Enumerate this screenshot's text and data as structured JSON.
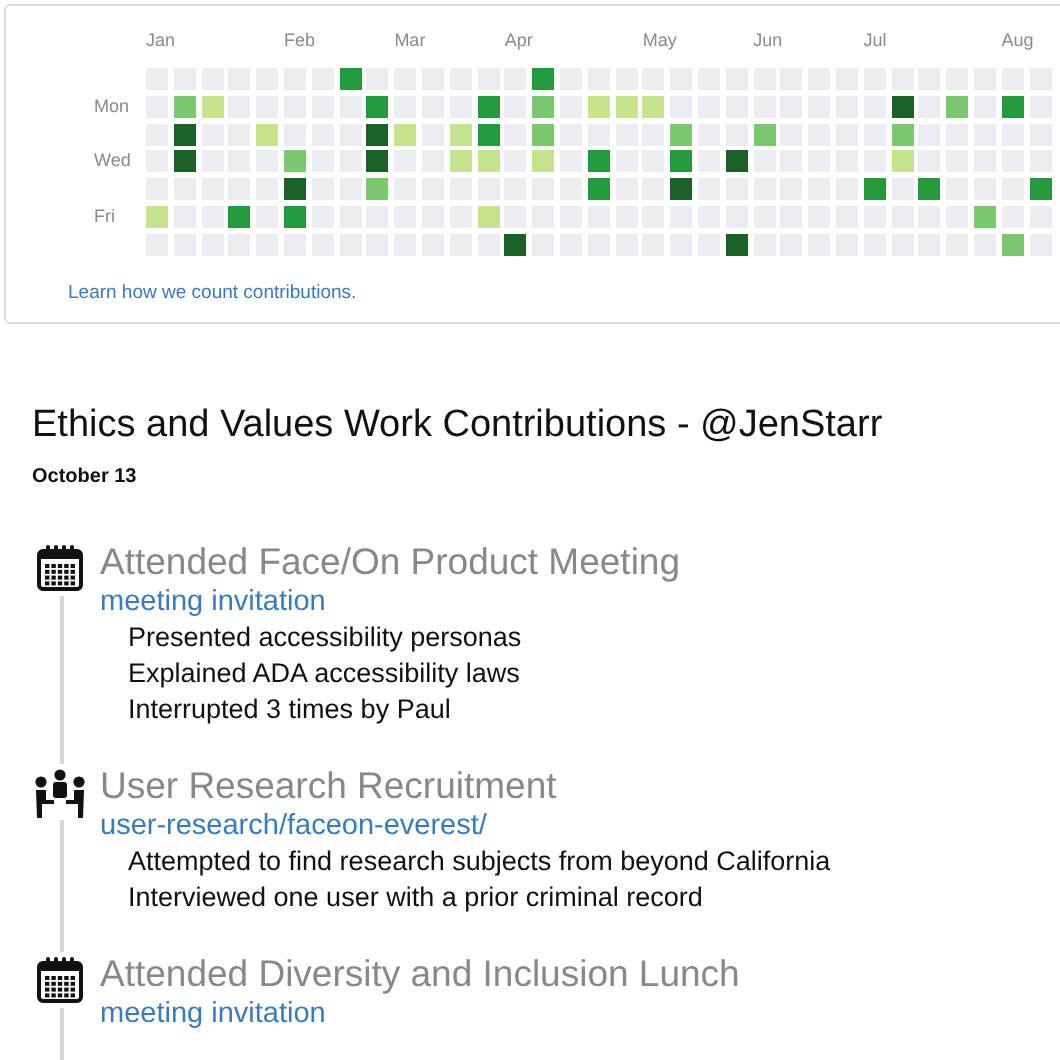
{
  "graph": {
    "months": [
      "Jan",
      "Feb",
      "Mar",
      "Apr",
      "May",
      "Jun",
      "Jul",
      "Aug"
    ],
    "day_labels": [
      "Mon",
      "Wed",
      "Fri"
    ],
    "weeks": [
      [
        {
          "color": "#ebedf0"
        },
        {
          "color": "#ebedf0"
        },
        {
          "color": "#ebedf0"
        },
        {
          "color": "#ebedf0"
        },
        {
          "color": "#ebedf0"
        },
        {
          "color": "#c6e48b"
        },
        {
          "color": "#ebedf0"
        }
      ],
      [
        {
          "color": "#ebedf0"
        },
        {
          "color": "#7bc96f"
        },
        {
          "color": "#196127"
        },
        {
          "color": "#196127"
        },
        {
          "color": "#ebedf0"
        },
        {
          "color": "#ebedf0"
        },
        {
          "color": "#ebedf0"
        }
      ],
      [
        {
          "color": "#ebedf0"
        },
        {
          "color": "#c6e48b"
        },
        {
          "color": "#ebedf0"
        },
        {
          "color": "#ebedf0"
        },
        {
          "color": "#ebedf0"
        },
        {
          "color": "#ebedf0"
        },
        {
          "color": "#ebedf0"
        }
      ],
      [
        {
          "color": "#ebedf0"
        },
        {
          "color": "#ebedf0"
        },
        {
          "color": "#ebedf0"
        },
        {
          "color": "#ebedf0"
        },
        {
          "color": "#ebedf0"
        },
        {
          "color": "#239a3b"
        },
        {
          "color": "#ebedf0"
        }
      ],
      [
        {
          "color": "#ebedf0"
        },
        {
          "color": "#ebedf0"
        },
        {
          "color": "#c6e48b"
        },
        {
          "color": "#ebedf0"
        },
        {
          "color": "#ebedf0"
        },
        {
          "color": "#ebedf0"
        },
        {
          "color": "#ebedf0"
        }
      ],
      [
        {
          "color": "#ebedf0"
        },
        {
          "color": "#ebedf0"
        },
        {
          "color": "#ebedf0"
        },
        {
          "color": "#7bc96f"
        },
        {
          "color": "#196127"
        },
        {
          "color": "#239a3b"
        },
        {
          "color": "#ebedf0"
        }
      ],
      [
        {
          "color": "#ebedf0"
        },
        {
          "color": "#ebedf0"
        },
        {
          "color": "#ebedf0"
        },
        {
          "color": "#ebedf0"
        },
        {
          "color": "#ebedf0"
        },
        {
          "color": "#ebedf0"
        },
        {
          "color": "#ebedf0"
        }
      ],
      [
        {
          "color": "#239a3b"
        },
        {
          "color": "#ebedf0"
        },
        {
          "color": "#ebedf0"
        },
        {
          "color": "#ebedf0"
        },
        {
          "color": "#ebedf0"
        },
        {
          "color": "#ebedf0"
        },
        {
          "color": "#ebedf0"
        }
      ],
      [
        {
          "color": "#ebedf0"
        },
        {
          "color": "#239a3b"
        },
        {
          "color": "#196127"
        },
        {
          "color": "#196127"
        },
        {
          "color": "#7bc96f"
        },
        {
          "color": "#ebedf0"
        },
        {
          "color": "#ebedf0"
        }
      ],
      [
        {
          "color": "#ebedf0"
        },
        {
          "color": "#ebedf0"
        },
        {
          "color": "#c6e48b"
        },
        {
          "color": "#ebedf0"
        },
        {
          "color": "#ebedf0"
        },
        {
          "color": "#ebedf0"
        },
        {
          "color": "#ebedf0"
        }
      ],
      [
        {
          "color": "#ebedf0"
        },
        {
          "color": "#ebedf0"
        },
        {
          "color": "#ebedf0"
        },
        {
          "color": "#ebedf0"
        },
        {
          "color": "#ebedf0"
        },
        {
          "color": "#ebedf0"
        },
        {
          "color": "#ebedf0"
        }
      ],
      [
        {
          "color": "#ebedf0"
        },
        {
          "color": "#ebedf0"
        },
        {
          "color": "#c6e48b"
        },
        {
          "color": "#c6e48b"
        },
        {
          "color": "#ebedf0"
        },
        {
          "color": "#ebedf0"
        },
        {
          "color": "#ebedf0"
        }
      ],
      [
        {
          "color": "#ebedf0"
        },
        {
          "color": "#239a3b"
        },
        {
          "color": "#239a3b"
        },
        {
          "color": "#c6e48b"
        },
        {
          "color": "#ebedf0"
        },
        {
          "color": "#c6e48b"
        },
        {
          "color": "#ebedf0"
        }
      ],
      [
        {
          "color": "#ebedf0"
        },
        {
          "color": "#ebedf0"
        },
        {
          "color": "#ebedf0"
        },
        {
          "color": "#ebedf0"
        },
        {
          "color": "#ebedf0"
        },
        {
          "color": "#ebedf0"
        },
        {
          "color": "#196127"
        }
      ],
      [
        {
          "color": "#239a3b"
        },
        {
          "color": "#7bc96f"
        },
        {
          "color": "#7bc96f"
        },
        {
          "color": "#c6e48b"
        },
        {
          "color": "#ebedf0"
        },
        {
          "color": "#ebedf0"
        },
        {
          "color": "#ebedf0"
        }
      ],
      [
        {
          "color": "#ebedf0"
        },
        {
          "color": "#ebedf0"
        },
        {
          "color": "#ebedf0"
        },
        {
          "color": "#ebedf0"
        },
        {
          "color": "#ebedf0"
        },
        {
          "color": "#ebedf0"
        },
        {
          "color": "#ebedf0"
        }
      ],
      [
        {
          "color": "#ebedf0"
        },
        {
          "color": "#c6e48b"
        },
        {
          "color": "#ebedf0"
        },
        {
          "color": "#239a3b"
        },
        {
          "color": "#239a3b"
        },
        {
          "color": "#ebedf0"
        },
        {
          "color": "#ebedf0"
        }
      ],
      [
        {
          "color": "#ebedf0"
        },
        {
          "color": "#c6e48b"
        },
        {
          "color": "#ebedf0"
        },
        {
          "color": "#ebedf0"
        },
        {
          "color": "#ebedf0"
        },
        {
          "color": "#ebedf0"
        },
        {
          "color": "#ebedf0"
        }
      ],
      [
        {
          "color": "#ebedf0"
        },
        {
          "color": "#c6e48b"
        },
        {
          "color": "#ebedf0"
        },
        {
          "color": "#ebedf0"
        },
        {
          "color": "#ebedf0"
        },
        {
          "color": "#ebedf0"
        },
        {
          "color": "#ebedf0"
        }
      ],
      [
        {
          "color": "#ebedf0"
        },
        {
          "color": "#ebedf0"
        },
        {
          "color": "#7bc96f"
        },
        {
          "color": "#239a3b"
        },
        {
          "color": "#196127"
        },
        {
          "color": "#ebedf0"
        },
        {
          "color": "#ebedf0"
        }
      ],
      [
        {
          "color": "#ebedf0"
        },
        {
          "color": "#ebedf0"
        },
        {
          "color": "#ebedf0"
        },
        {
          "color": "#ebedf0"
        },
        {
          "color": "#ebedf0"
        },
        {
          "color": "#ebedf0"
        },
        {
          "color": "#ebedf0"
        }
      ],
      [
        {
          "color": "#ebedf0"
        },
        {
          "color": "#ebedf0"
        },
        {
          "color": "#ebedf0"
        },
        {
          "color": "#196127"
        },
        {
          "color": "#ebedf0"
        },
        {
          "color": "#ebedf0"
        },
        {
          "color": "#196127"
        }
      ],
      [
        {
          "color": "#ebedf0"
        },
        {
          "color": "#ebedf0"
        },
        {
          "color": "#7bc96f"
        },
        {
          "color": "#ebedf0"
        },
        {
          "color": "#ebedf0"
        },
        {
          "color": "#ebedf0"
        },
        {
          "color": "#ebedf0"
        }
      ],
      [
        {
          "color": "#ebedf0"
        },
        {
          "color": "#ebedf0"
        },
        {
          "color": "#ebedf0"
        },
        {
          "color": "#ebedf0"
        },
        {
          "color": "#ebedf0"
        },
        {
          "color": "#ebedf0"
        },
        {
          "color": "#ebedf0"
        }
      ],
      [
        {
          "color": "#ebedf0"
        },
        {
          "color": "#ebedf0"
        },
        {
          "color": "#ebedf0"
        },
        {
          "color": "#ebedf0"
        },
        {
          "color": "#ebedf0"
        },
        {
          "color": "#ebedf0"
        },
        {
          "color": "#ebedf0"
        }
      ],
      [
        {
          "color": "#ebedf0"
        },
        {
          "color": "#ebedf0"
        },
        {
          "color": "#ebedf0"
        },
        {
          "color": "#ebedf0"
        },
        {
          "color": "#ebedf0"
        },
        {
          "color": "#ebedf0"
        },
        {
          "color": "#ebedf0"
        }
      ],
      [
        {
          "color": "#ebedf0"
        },
        {
          "color": "#ebedf0"
        },
        {
          "color": "#ebedf0"
        },
        {
          "color": "#ebedf0"
        },
        {
          "color": "#239a3b"
        },
        {
          "color": "#ebedf0"
        },
        {
          "color": "#ebedf0"
        }
      ],
      [
        {
          "color": "#ebedf0"
        },
        {
          "color": "#196127"
        },
        {
          "color": "#7bc96f"
        },
        {
          "color": "#c6e48b"
        },
        {
          "color": "#ebedf0"
        },
        {
          "color": "#ebedf0"
        },
        {
          "color": "#ebedf0"
        }
      ],
      [
        {
          "color": "#ebedf0"
        },
        {
          "color": "#ebedf0"
        },
        {
          "color": "#ebedf0"
        },
        {
          "color": "#ebedf0"
        },
        {
          "color": "#239a3b"
        },
        {
          "color": "#ebedf0"
        },
        {
          "color": "#ebedf0"
        }
      ],
      [
        {
          "color": "#ebedf0"
        },
        {
          "color": "#7bc96f"
        },
        {
          "color": "#ebedf0"
        },
        {
          "color": "#ebedf0"
        },
        {
          "color": "#ebedf0"
        },
        {
          "color": "#ebedf0"
        },
        {
          "color": "#ebedf0"
        }
      ],
      [
        {
          "color": "#ebedf0"
        },
        {
          "color": "#ebedf0"
        },
        {
          "color": "#ebedf0"
        },
        {
          "color": "#ebedf0"
        },
        {
          "color": "#ebedf0"
        },
        {
          "color": "#7bc96f"
        },
        {
          "color": "#ebedf0"
        }
      ],
      [
        {
          "color": "#ebedf0"
        },
        {
          "color": "#239a3b"
        },
        {
          "color": "#ebedf0"
        },
        {
          "color": "#ebedf0"
        },
        {
          "color": "#ebedf0"
        },
        {
          "color": "#ebedf0"
        },
        {
          "color": "#7bc96f"
        }
      ],
      [
        {
          "color": "#ebedf0"
        },
        {
          "color": "#ebedf0"
        },
        {
          "color": "#ebedf0"
        },
        {
          "color": "#ebedf0"
        },
        {
          "color": "#239a3b"
        },
        {
          "color": "#ebedf0"
        },
        {
          "color": "#ebedf0"
        }
      ]
    ],
    "link": "Learn how we count contributions."
  },
  "title": "Ethics and Values Work Contributions - @JenStarr",
  "date": "October 13",
  "events": [
    {
      "kind": "calendar",
      "title": "Attended Face/On Product Meeting",
      "link": "meeting invitation",
      "details": [
        "Presented accessibility personas",
        "Explained ADA accessibility laws",
        "Interrupted 3 times by Paul"
      ]
    },
    {
      "kind": "people",
      "title": "User Research Recruitment",
      "link": "user-research/faceon-everest/",
      "details": [
        "Attempted to find research subjects from beyond California",
        "Interviewed one user with a prior criminal record"
      ]
    },
    {
      "kind": "calendar",
      "title": "Attended Diversity and Inclusion Lunch",
      "link": "meeting invitation"
    }
  ]
}
